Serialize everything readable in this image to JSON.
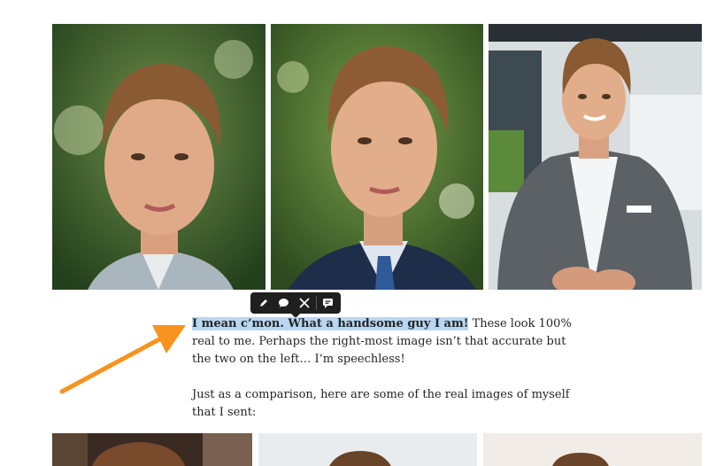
{
  "toolbar": {
    "items": [
      {
        "name": "highlight",
        "icon": "pencil-icon"
      },
      {
        "name": "respond",
        "icon": "speech-bubble-icon"
      },
      {
        "name": "share-x",
        "icon": "x-logo-icon"
      },
      {
        "name": "private-note",
        "icon": "note-icon"
      }
    ]
  },
  "article": {
    "highlighted": "I mean c’mon. What a handsome guy I am!",
    "rest": " These look 100% real to me. Perhaps the right-most image isn’t that accurate but the two on the left… I’m speechless!",
    "paragraph2": "Just as a comparison, here are some of the real images of myself that I sent:"
  },
  "annotation": {
    "arrow_color": "#f7931e"
  },
  "colors": {
    "highlight": "#b9d7f2",
    "toolbar": "#1f1f1f",
    "text": "#242424"
  }
}
